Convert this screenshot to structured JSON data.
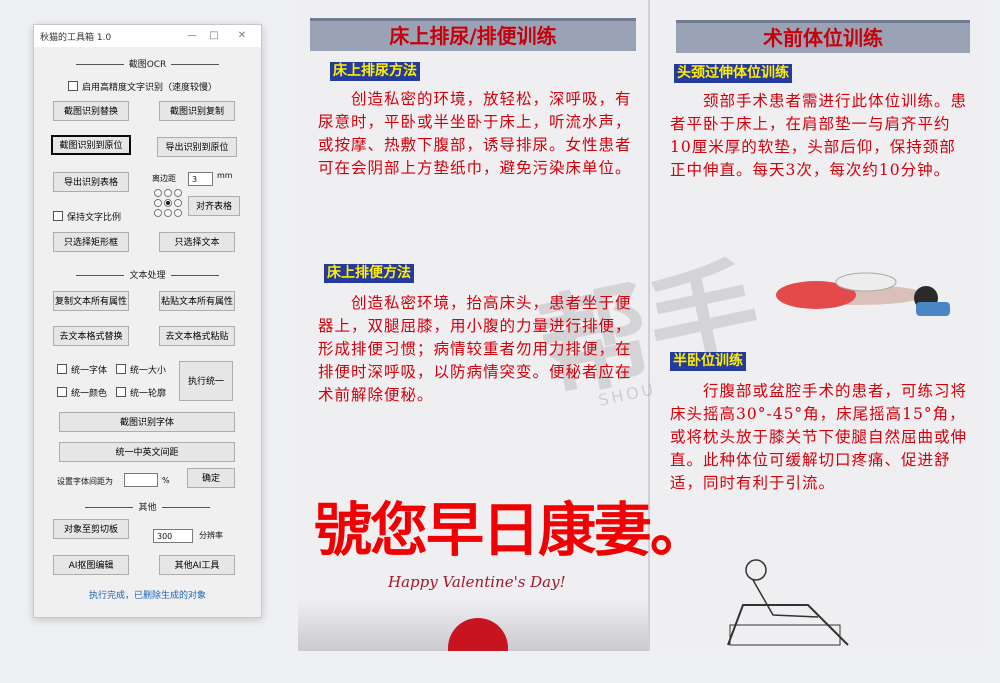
{
  "window": {
    "title": "秋猫的工具箱 1.0",
    "min_glyph": "—",
    "max_glyph": "□",
    "close_glyph": "✕"
  },
  "ocr": {
    "section_title": "截图OCR",
    "high_precision_label": "启用高精度文字识别（速度较慢）",
    "btn_replace": "截图识别替换",
    "btn_copy": "截图识别复制",
    "btn_to_origin": "截图识别到原位",
    "btn_export_origin": "导出识别到原位",
    "btn_export_table": "导出识别表格",
    "margin_label": "离边距",
    "margin_value": "3",
    "margin_unit": "mm",
    "btn_align_table": "对齐表格",
    "keep_ratio_label": "保持文字比例",
    "btn_select_shapes": "只选择矩形框",
    "btn_select_text": "只选择文本"
  },
  "text": {
    "section_title": "文本处理",
    "btn_copy_attr": "复制文本所有属性",
    "btn_paste_attr": "粘贴文本所有属性",
    "btn_clear_replace": "去文本格式替换",
    "btn_clear_paste": "去文本格式粘贴",
    "chk_font": "统一字体",
    "chk_size": "统一大小",
    "chk_color": "统一颜色",
    "chk_outline": "统一轮廓",
    "btn_apply_unify": "执行统一",
    "btn_detect_font": "截图识别字体",
    "btn_spacing": "统一中英文间距",
    "spacing_label": "设置字体间距为",
    "spacing_value": "",
    "spacing_unit": "%",
    "btn_confirm": "确定"
  },
  "other": {
    "section_title": "其他",
    "btn_to_clipboard": "对象至剪切板",
    "dpi_value": "300",
    "dpi_label": "分辨率",
    "btn_ai_matting": "AI抠图编辑",
    "btn_other_ai": "其他AI工具"
  },
  "status_text": "执行完成，已删除生成的对象",
  "doc": {
    "left_header": "床上排尿/排便训练",
    "right_header": "术前体位训练",
    "sub1": "床上排尿方法",
    "para1": "　　创造私密的环境，放轻松，深呼吸，有尿意时，平卧或半坐卧于床上，听流水声，或按摩、热敷下腹部，诱导排尿。女性患者可在会阴部上方垫纸巾，避免污染床单位。",
    "sub2": "床上排便方法",
    "para2": "　　创造私密环境，抬高床头，患者坐于便器上，双腿屈膝，用小腹的力量进行排便，形成排便习惯；病情较重者勿用力排便，在排便时深呼吸，以防病情突变。便秘者应在术前解除便秘。",
    "sub3": "头颈过伸体位训练",
    "para3": "　　颈部手术患者需进行此体位训练。患者平卧于床上，在肩部垫一与肩齐平约10厘米厚的软垫，头部后仰，保持颈部正中伸直。每天3次，每次约10分钟。",
    "sub4": "半卧位训练",
    "para4": "　　行腹部或盆腔手术的患者，可练习将床头摇高30°-45°角，床尾摇高15°角，或将枕头放于膝关节下使腿自然屈曲或伸直。此种体位可缓解切口疼痛、促进舒适，同时有利于引流。",
    "overlay_text": "號您早日康妻。",
    "valentine": "Happy Valentine's Day!",
    "watermark": "帮手",
    "watermark_small": "SHOU"
  }
}
